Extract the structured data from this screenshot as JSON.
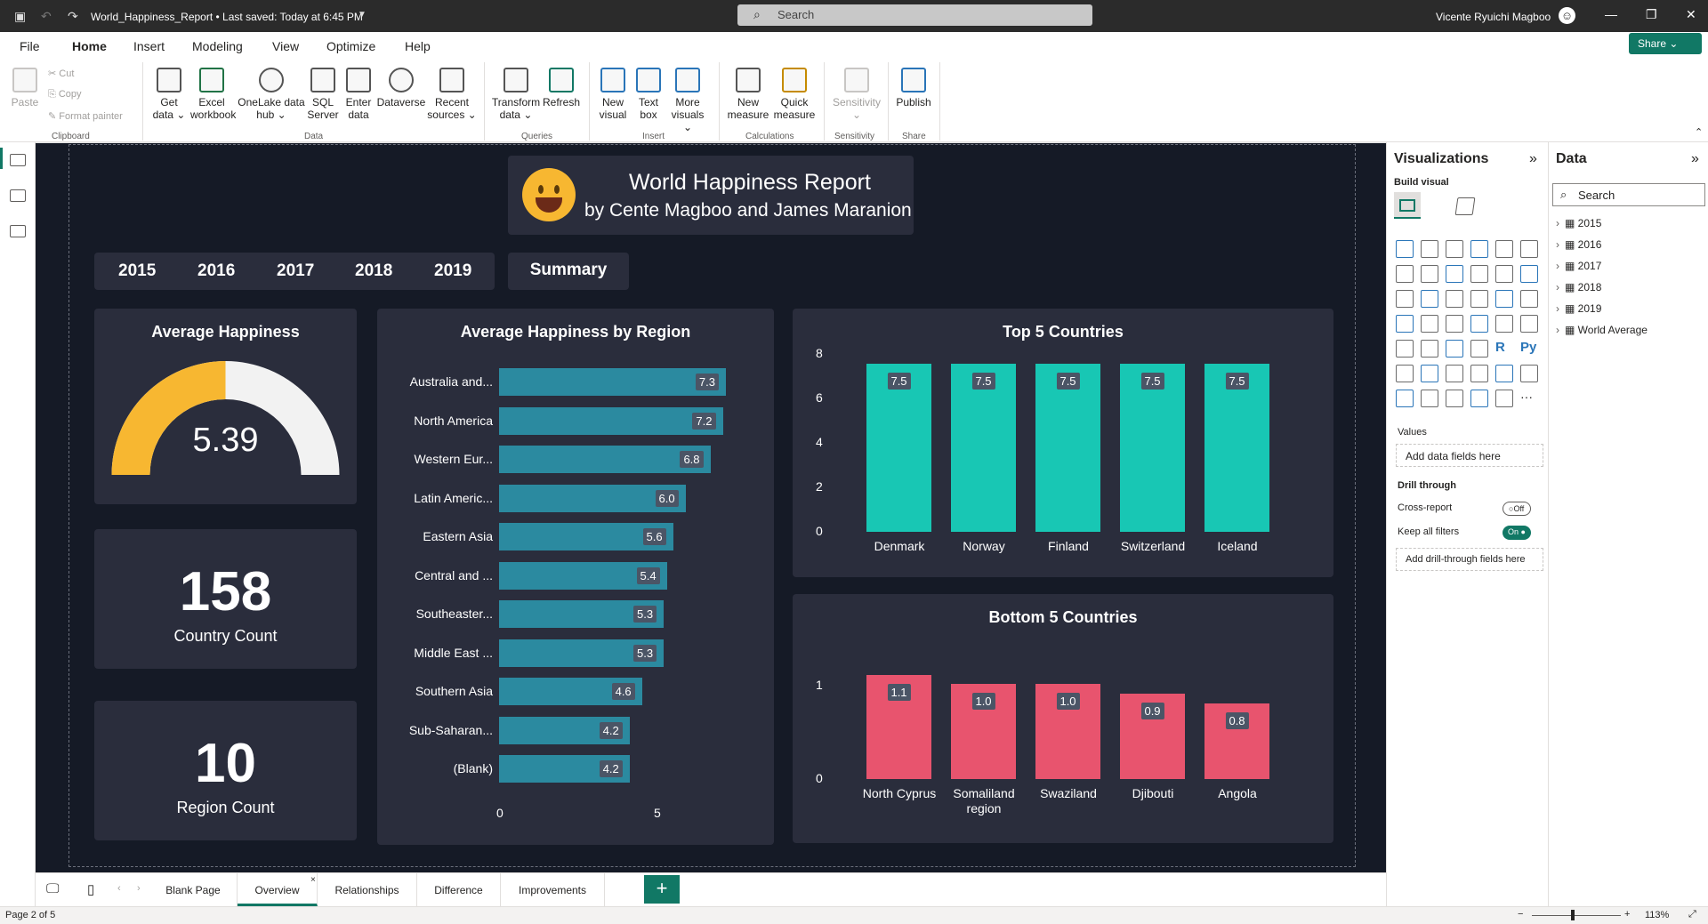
{
  "titlebar": {
    "doc_title": "World_Happiness_Report • Last saved: Today at 6:45 PM",
    "search_placeholder": "Search",
    "user": "Vicente Ryuichi Magboo"
  },
  "menu": [
    "File",
    "Home",
    "Insert",
    "Modeling",
    "View",
    "Optimize",
    "Help"
  ],
  "share_label": "Share",
  "ribbon": {
    "clipboard": {
      "paste": "Paste",
      "cut": "Cut",
      "copy": "Copy",
      "format_painter": "Format painter",
      "group": "Clipboard"
    },
    "data_buttons": [
      {
        "l1": "Get",
        "l2": "data ⌄"
      },
      {
        "l1": "Excel",
        "l2": "workbook"
      },
      {
        "l1": "OneLake data",
        "l2": "hub ⌄"
      },
      {
        "l1": "SQL",
        "l2": "Server"
      },
      {
        "l1": "Enter",
        "l2": "data"
      },
      {
        "l1": "Dataverse",
        "l2": ""
      },
      {
        "l1": "Recent",
        "l2": "sources ⌄"
      }
    ],
    "data_group": "Data",
    "queries_buttons": [
      {
        "l1": "Transform",
        "l2": "data ⌄"
      },
      {
        "l1": "Refresh",
        "l2": ""
      }
    ],
    "queries_group": "Queries",
    "insert_buttons": [
      {
        "l1": "New",
        "l2": "visual"
      },
      {
        "l1": "Text",
        "l2": "box"
      },
      {
        "l1": "More",
        "l2": "visuals ⌄"
      }
    ],
    "insert_group": "Insert",
    "calc_buttons": [
      {
        "l1": "New",
        "l2": "measure"
      },
      {
        "l1": "Quick",
        "l2": "measure"
      }
    ],
    "calc_group": "Calculations",
    "sensitivity_button": {
      "l1": "Sensitivity",
      "l2": "⌄"
    },
    "sensitivity_group": "Sensitivity",
    "publish_button": {
      "l1": "Publish",
      "l2": ""
    },
    "share_group": "Share"
  },
  "report": {
    "title": "World Happiness Report",
    "subtitle": "by Cente Magboo and James Maranion",
    "years": [
      "2015",
      "2016",
      "2017",
      "2018",
      "2019"
    ],
    "summary_label": "Summary",
    "avg_happiness": {
      "title": "Average Happiness",
      "value": "5.39",
      "fraction": 0.5
    },
    "country_count": {
      "value": "158",
      "label": "Country Count"
    },
    "region_count": {
      "value": "10",
      "label": "Region Count"
    }
  },
  "chart_data": [
    {
      "type": "bar",
      "orientation": "horizontal",
      "title": "Average Happiness by Region",
      "categories": [
        "Australia and...",
        "North America",
        "Western Eur...",
        "Latin Americ...",
        "Eastern Asia",
        "Central and ...",
        "Southeaster...",
        "Middle East ...",
        "Southern Asia",
        "Sub-Saharan...",
        "(Blank)"
      ],
      "values": [
        7.3,
        7.2,
        6.8,
        6.0,
        5.6,
        5.4,
        5.3,
        5.3,
        4.6,
        4.2,
        4.2
      ],
      "data_labels": [
        "7.3",
        "7.2",
        "6.8",
        "6.0",
        "5.6",
        "5.4",
        "5.3",
        "5.3",
        "4.6",
        "4.2",
        "4.2"
      ],
      "xticks": [
        "0",
        "5"
      ],
      "xlim": [
        0,
        7.5
      ],
      "color": "#2b8aa0"
    },
    {
      "type": "bar",
      "title": "Top 5 Countries",
      "categories": [
        "Denmark",
        "Norway",
        "Finland",
        "Switzerland",
        "Iceland"
      ],
      "values": [
        7.5,
        7.5,
        7.5,
        7.5,
        7.5
      ],
      "data_labels": [
        "7.5",
        "7.5",
        "7.5",
        "7.5",
        "7.5"
      ],
      "yticks": [
        "8",
        "6",
        "4",
        "2",
        "0"
      ],
      "ylim": [
        0,
        8
      ],
      "color": "#18c7b4"
    },
    {
      "type": "bar",
      "title": "Bottom 5 Countries",
      "categories": [
        "North Cyprus",
        "Somaliland region",
        "Swaziland",
        "Djibouti",
        "Angola"
      ],
      "category_lines": [
        [
          "North Cyprus"
        ],
        [
          "Somaliland",
          "region"
        ],
        [
          "Swaziland"
        ],
        [
          "Djibouti"
        ],
        [
          "Angola"
        ]
      ],
      "values": [
        1.1,
        1.0,
        1.0,
        0.9,
        0.8
      ],
      "data_labels": [
        "1.1",
        "1.0",
        "1.0",
        "0.9",
        "0.8"
      ],
      "yticks": [
        "1",
        "0"
      ],
      "ylim": [
        0,
        1.2
      ],
      "color": "#e8546e"
    }
  ],
  "viz_pane": {
    "title": "Visualizations",
    "build_visual": "Build visual",
    "values_label": "Values",
    "values_placeholder": "Add data fields here",
    "drill_through": "Drill through",
    "cross_report": "Cross-report",
    "cross_report_state": "Off",
    "keep_filters": "Keep all filters",
    "keep_filters_state": "On",
    "drill_placeholder": "Add drill-through fields here",
    "icon_r": "R",
    "icon_py": "Py",
    "icon_more": "···"
  },
  "data_pane": {
    "title": "Data",
    "search_placeholder": "Search",
    "tables": [
      "2015",
      "2016",
      "2017",
      "2018",
      "2019",
      "World Average"
    ]
  },
  "tabs": [
    "Blank Page",
    "Overview",
    "Relationships",
    "Difference",
    "Improvements"
  ],
  "active_tab": "Overview",
  "status": {
    "page": "Page 2 of 5",
    "zoom": "113%"
  }
}
